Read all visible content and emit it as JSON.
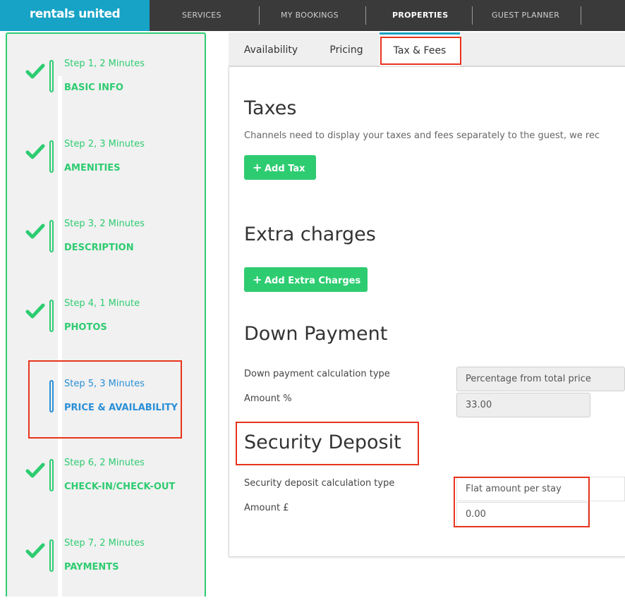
{
  "logo": "rentals united",
  "nav": {
    "items": [
      {
        "label": "SERVICES"
      },
      {
        "label": "MY BOOKINGS"
      },
      {
        "label": "PROPERTIES"
      },
      {
        "label": "GUEST PLANNER"
      }
    ],
    "active": "PROPERTIES"
  },
  "sidebar": {
    "steps": [
      {
        "sub": "Step 1, 2 Minutes",
        "title": "BASIC INFO",
        "status": "complete"
      },
      {
        "sub": "Step 2, 3 Minutes",
        "title": "AMENITIES",
        "status": "complete"
      },
      {
        "sub": "Step 3, 2 Minutes",
        "title": "DESCRIPTION",
        "status": "complete"
      },
      {
        "sub": "Step 4, 1 Minute",
        "title": "PHOTOS",
        "status": "complete"
      },
      {
        "sub": "Step 5, 3 Minutes",
        "title": "PRICE & AVAILABILITY",
        "status": "current"
      },
      {
        "sub": "Step 6, 2 Minutes",
        "title": "CHECK-IN/CHECK-OUT",
        "status": "complete"
      },
      {
        "sub": "Step 7, 2 Minutes",
        "title": "PAYMENTS",
        "status": "complete"
      }
    ]
  },
  "tabs": [
    {
      "label": "Availability"
    },
    {
      "label": "Pricing"
    },
    {
      "label": "Tax & Fees"
    }
  ],
  "selected_tab": "Tax & Fees",
  "taxes": {
    "heading": "Taxes",
    "description": "Channels need to display your taxes and fees separately to the guest, we rec",
    "button": "Add Tax"
  },
  "extra_charges": {
    "heading": "Extra charges",
    "button": "Add Extra Charges"
  },
  "down_payment": {
    "heading": "Down Payment",
    "calc_label": "Down payment calculation type",
    "calc_value": "Percentage from total price",
    "amount_label": "Amount %",
    "amount_value": "33.00"
  },
  "security_deposit": {
    "heading": "Security Deposit",
    "calc_label": "Security deposit calculation type",
    "calc_value": "Flat amount per stay",
    "amount_label": "Amount £",
    "amount_value": "0.00"
  },
  "colors": {
    "brand": "#16a3c6",
    "success": "#2ecc71",
    "current": "#2a8fd6",
    "highlight": "#e8331c",
    "nav_bg": "#3a3a3a"
  },
  "icons": {
    "step_complete": "checkmark-icon",
    "add": "plus-icon"
  }
}
